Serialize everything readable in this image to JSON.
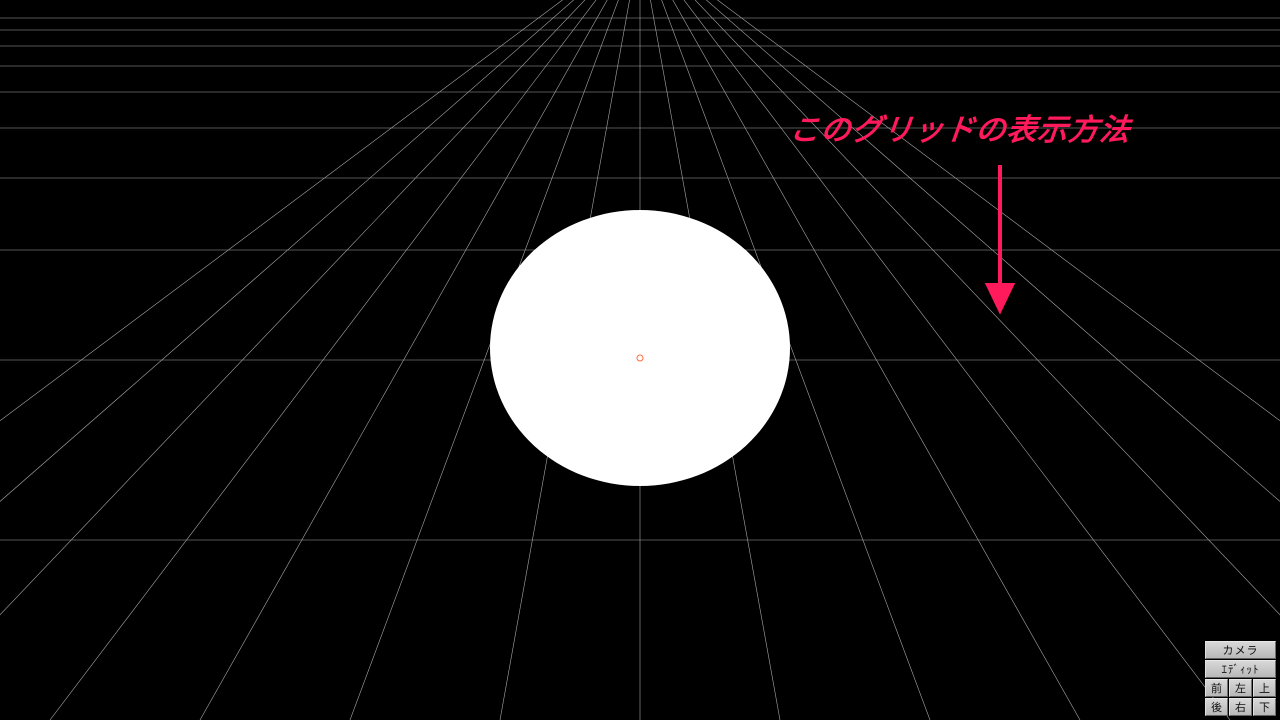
{
  "annotation": {
    "text": "このグリッドの表示方法"
  },
  "buttons": {
    "camera": "カメラ",
    "edit": "ｴﾃﾞｨｯﾄ",
    "front": "前",
    "left": "左",
    "top": "上",
    "back": "後",
    "right": "右",
    "bottom": "下"
  },
  "scene": {
    "object": "white-sphere",
    "grid": "perspective-floor-grid",
    "pivot_marker": "origin-pivot"
  },
  "colors": {
    "annotation": "#ff1a5c",
    "grid_line": "#bbbbbb",
    "sphere": "#ffffff",
    "background": "#000000"
  }
}
